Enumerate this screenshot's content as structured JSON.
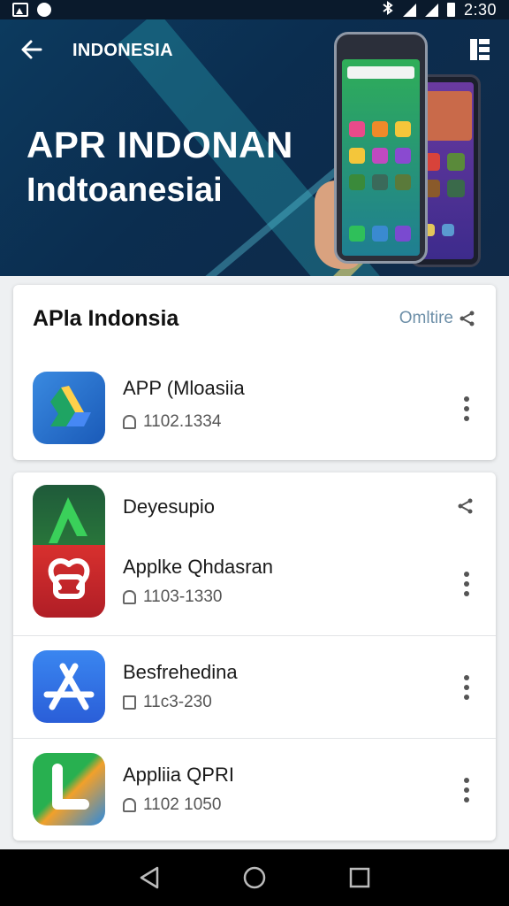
{
  "status_bar": {
    "time": "2:30"
  },
  "header": {
    "title": "INDONESIA",
    "headline_1": "APR INDONAN",
    "headline_2": "Indtoanesiai"
  },
  "section": {
    "title": "APla Indonsia",
    "link_label": "Omltire"
  },
  "featured_app": {
    "name": "APP (Mloasiia",
    "meta": "1102.1334"
  },
  "group_header": {
    "label": "Deyesupio"
  },
  "apps": [
    {
      "name": "Applke Qhdasran",
      "meta": "1103-1330"
    },
    {
      "name": "Besfrehedina",
      "meta": "11c3-230"
    },
    {
      "name": "Appliia QPRI",
      "meta": "1102 1050"
    }
  ],
  "colors": {
    "hero_bg": "#0b2d4f",
    "accent_link": "#6d8fa8",
    "drive_green": "#1fa463",
    "drive_yellow": "#ffd04b",
    "drive_blue": "#4688f4",
    "red_app": "#c8262c",
    "blue_app": "#2f6fe0"
  },
  "icons": [
    "back-arrow-icon",
    "menu-icon",
    "share-icon",
    "more-vert-icon",
    "download-icon",
    "nav-back-icon",
    "nav-home-icon",
    "nav-recents-icon"
  ]
}
